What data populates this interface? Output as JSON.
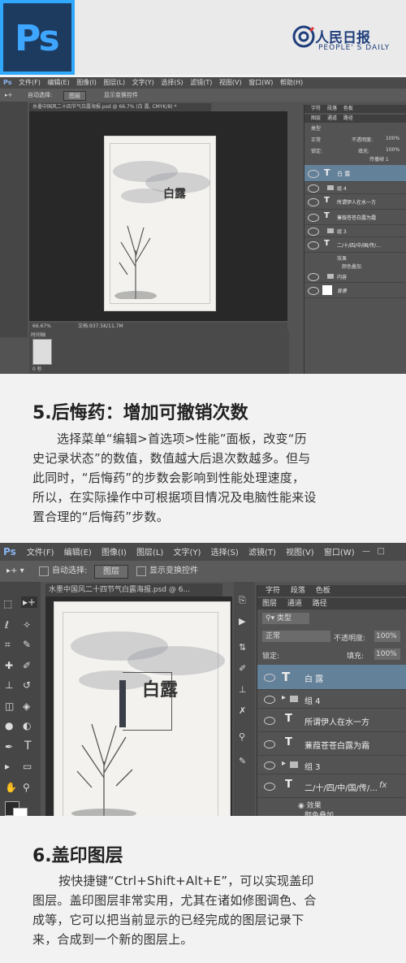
{
  "header": {
    "ps_logo": "Ps",
    "brand_cn": "人民日报",
    "brand_en": "PEOPLE' S DAILY"
  },
  "shot1": {
    "app_icon": "Ps",
    "menus": [
      "文件(F)",
      "编辑(E)",
      "图像(I)",
      "图层(L)",
      "文字(Y)",
      "选择(S)",
      "滤镜(T)",
      "视图(V)",
      "窗口(W)",
      "帮助(H)"
    ],
    "auto_select_label": "自动选择:",
    "auto_select_value": "图层",
    "show_transform": "显示变换控件",
    "doc_tab": "水墨中国风二十四节气白露海报.psd @ 66.7% (白 露, CMYK/8) *",
    "zoom": "66.67%",
    "doc_info": "文档:937.5K/11.7M",
    "timeline_label": "时间轴",
    "timeline_time": "0 秒",
    "poster_title": "白露",
    "panel_tabs": [
      "字符",
      "段落",
      "色板"
    ],
    "layer_tabs": [
      "图层",
      "通道",
      "路径"
    ],
    "kind": "类型",
    "blend": "正常",
    "opacity_label": "不透明度:",
    "opacity": "100%",
    "lock_label": "锁定:",
    "fill_label": "填充:",
    "fill": "100%",
    "propagate": "传播帧 1",
    "layers": [
      "白 露",
      "组 4",
      "所谓伊人在水一方",
      "蒹葭苍苍白露为霜",
      "组 3",
      "二/十/四/中/国/传/...",
      "效果",
      "颜色叠加",
      "内容",
      "背景"
    ]
  },
  "section5": {
    "title": "5.后悔药：增加可撤销次数",
    "lines": [
      "选择菜单“编辑>首选项>性能”面板，改变“历",
      "史记录状态”的数值，数值越大后退次数越多。但与",
      "此同时，“后悔药”的步数会影响到性能处理速度，",
      "所以，在实际操作中可根据项目情况及电脑性能来设",
      "置合理的“后悔药”步数。"
    ]
  },
  "shot2": {
    "app_icon": "Ps",
    "menus": [
      "文件(F)",
      "编辑(E)",
      "图像(I)",
      "图层(L)",
      "文字(Y)",
      "选择(S)",
      "滤镜(T)",
      "视图(V)",
      "窗口(W)"
    ],
    "auto_select_label": "自动选择:",
    "auto_select_value": "图层",
    "show_transform": "显示变换控件",
    "doc_tab": "水墨中国风二十四节气白露海报.psd @ 6...",
    "poster_title": "白露",
    "panel_tabs": [
      "字符",
      "段落",
      "色板"
    ],
    "layer_tabs": [
      "图层",
      "通道",
      "路径"
    ],
    "kind": "类型",
    "blend": "正常",
    "opacity_label": "不透明度:",
    "opacity": "100%",
    "lock_label": "锁定:",
    "fill_label": "填充:",
    "fill": "100%",
    "layers": [
      "白 露",
      "组 4",
      "所谓伊人在水一方",
      "蒹葭苍苍白露为霜",
      "组 3",
      "二/十/四/中/国/传/...",
      "效果",
      "颜色叠加"
    ],
    "fx": "fx"
  },
  "section6": {
    "title": "6.盖印图层",
    "lines": [
      "按快捷键“Ctrl+Shift+Alt+E”，可以实现盖印",
      "图层。盖印图层非常实用，尤其在诸如修图调色、合",
      "成等，它可以把当前显示的已经完成的图层记录下",
      "来，合成到一个新的图层上。"
    ]
  },
  "colors": {
    "ps_blue": "#31a8ff",
    "ps_dark": "#1d3a5f",
    "brand_blue": "#1f3e7c",
    "selected_layer": "#64819a"
  }
}
